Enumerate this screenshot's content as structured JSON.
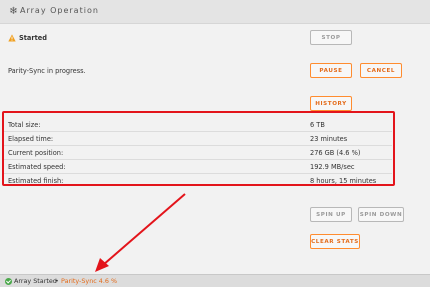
{
  "header": {
    "title": "Array Operation",
    "icon": "gear-icon"
  },
  "state": {
    "label": "Started",
    "icon": "warning-icon",
    "icon_color": "#f0a020"
  },
  "stop_label": "STOP",
  "sync": {
    "message": "Parity-Sync in progress.",
    "pause_label": "PAUSE",
    "cancel_label": "CANCEL",
    "history_label": "HISTORY"
  },
  "stats": [
    {
      "label": "Total size:",
      "value": "6 TB"
    },
    {
      "label": "Elapsed time:",
      "value": "23 minutes"
    },
    {
      "label": "Current position:",
      "value": "276 GB (4.6 %)"
    },
    {
      "label": "Estimated speed:",
      "value": "192.9 MB/sec"
    },
    {
      "label": "Estimated finish:",
      "value": "8 hours, 15 minutes"
    }
  ],
  "spin": {
    "up_label": "SPIN UP",
    "down_label": "SPIN DOWN"
  },
  "clear_stats_label": "CLEAR STATS",
  "statusbar": {
    "array_status": "Array Started",
    "separator": "•",
    "sync_status": "Parity-Sync 4.6 %"
  },
  "colors": {
    "accent": "#e46b1a",
    "highlight": "#e3141b",
    "ok": "#4aa84a"
  }
}
